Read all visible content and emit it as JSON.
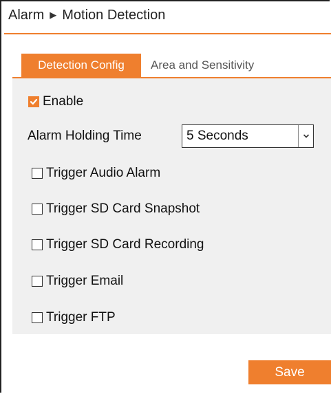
{
  "breadcrumb": {
    "section": "Alarm",
    "page": "Motion Detection"
  },
  "tabs": [
    {
      "label": "Detection Config",
      "active": true
    },
    {
      "label": "Area and Sensitivity",
      "active": false
    }
  ],
  "form": {
    "enable": {
      "label": "Enable",
      "checked": true
    },
    "holding_time": {
      "label": "Alarm Holding Time",
      "value": "5 Seconds"
    },
    "triggers": [
      {
        "label": "Trigger Audio Alarm",
        "checked": false
      },
      {
        "label": "Trigger SD Card Snapshot",
        "checked": false
      },
      {
        "label": "Trigger SD Card Recording",
        "checked": false
      },
      {
        "label": "Trigger Email",
        "checked": false
      },
      {
        "label": "Trigger FTP",
        "checked": false
      }
    ]
  },
  "actions": {
    "save_label": "Save"
  },
  "colors": {
    "accent": "#ef7f2e",
    "panel_bg": "#f0f0f0"
  },
  "icons": {
    "breadcrumb_separator": "triangle-right-icon",
    "dropdown": "chevron-down-icon",
    "check": "checkmark-icon"
  }
}
